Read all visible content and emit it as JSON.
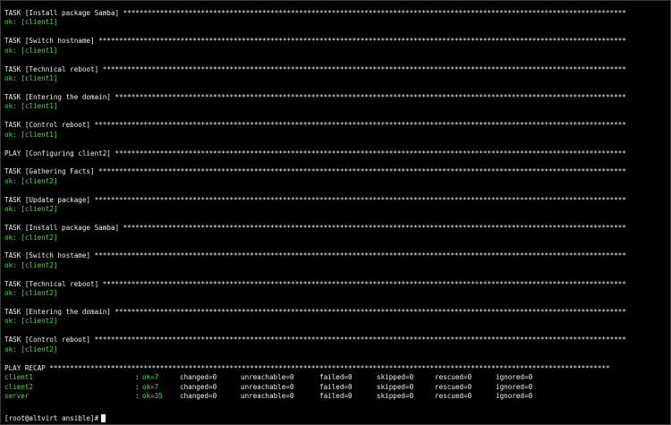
{
  "terminal": {
    "lines": [
      {
        "text": "TASK [Install package Samba] ***************************************************************************************************************************",
        "color": "white"
      },
      {
        "text": "ok: [client1]",
        "color": "green"
      },
      {
        "text": "",
        "color": "white"
      },
      {
        "text": "TASK [Switch hostname] *********************************************************************************************************************************",
        "color": "white"
      },
      {
        "text": "ok: [client1]",
        "color": "green"
      },
      {
        "text": "",
        "color": "white"
      },
      {
        "text": "TASK [Technical reboot] ********************************************************************************************************************************",
        "color": "white"
      },
      {
        "text": "ok: [client1]",
        "color": "green"
      },
      {
        "text": "",
        "color": "white"
      },
      {
        "text": "TASK [Entering the domain] *****************************************************************************************************************************",
        "color": "white"
      },
      {
        "text": "ok: [client1]",
        "color": "green"
      },
      {
        "text": "",
        "color": "white"
      },
      {
        "text": "TASK [Control reboot] **********************************************************************************************************************************",
        "color": "white"
      },
      {
        "text": "ok: [client1]",
        "color": "green"
      },
      {
        "text": "",
        "color": "white"
      },
      {
        "text": "PLAY [Configuring client2] *****************************************************************************************************************************",
        "color": "white"
      },
      {
        "text": "",
        "color": "white"
      },
      {
        "text": "TASK [Gathering Facts] *********************************************************************************************************************************",
        "color": "white"
      },
      {
        "text": "ok: [client2]",
        "color": "green"
      },
      {
        "text": "",
        "color": "white"
      },
      {
        "text": "TASK [Update package] **********************************************************************************************************************************",
        "color": "white"
      },
      {
        "text": "ok: [client2]",
        "color": "green"
      },
      {
        "text": "",
        "color": "white"
      },
      {
        "text": "TASK [Install package Samba] ***************************************************************************************************************************",
        "color": "white"
      },
      {
        "text": "ok: [client2]",
        "color": "green"
      },
      {
        "text": "",
        "color": "white"
      },
      {
        "text": "TASK [Switch hostame] **********************************************************************************************************************************",
        "color": "white"
      },
      {
        "text": "ok: [client2]",
        "color": "green"
      },
      {
        "text": "",
        "color": "white"
      },
      {
        "text": "TASK [Technical reboot] ********************************************************************************************************************************",
        "color": "white"
      },
      {
        "text": "ok: [client2]",
        "color": "green"
      },
      {
        "text": "",
        "color": "white"
      },
      {
        "text": "TASK [Entering the domain] *****************************************************************************************************************************",
        "color": "white"
      },
      {
        "text": "ok: [client2]",
        "color": "green"
      },
      {
        "text": "",
        "color": "white"
      },
      {
        "text": "TASK [Control reboot] **********************************************************************************************************************************",
        "color": "white"
      },
      {
        "text": "ok: [client2]",
        "color": "green"
      },
      {
        "text": "",
        "color": "white"
      },
      {
        "text": "PLAY RECAP *****************************************************************************************************************************************",
        "color": "white"
      }
    ],
    "recap": [
      {
        "host": "client1",
        "colon": ":",
        "ok": "ok=7",
        "changed": "changed=0",
        "unreachable": "unreachable=0",
        "failed": "failed=0",
        "skipped": "skipped=0",
        "rescued": "rescued=0",
        "ignored": "ignored=0"
      },
      {
        "host": "client2",
        "colon": ":",
        "ok": "ok=7",
        "changed": "changed=0",
        "unreachable": "unreachable=0",
        "failed": "failed=0",
        "skipped": "skipped=0",
        "rescued": "rescued=0",
        "ignored": "ignored=0"
      },
      {
        "host": "server",
        "colon": ":",
        "ok": "ok=35",
        "changed": "changed=0",
        "unreachable": "unreachable=0",
        "failed": "failed=0",
        "skipped": "skipped=0",
        "rescued": "rescued=0",
        "ignored": "ignored=0"
      }
    ],
    "prompt": "[root@altvirt ansible]#",
    "colors": {
      "background": "#000000",
      "text": "#f2f2f2",
      "ok": "#5fd35f"
    }
  }
}
